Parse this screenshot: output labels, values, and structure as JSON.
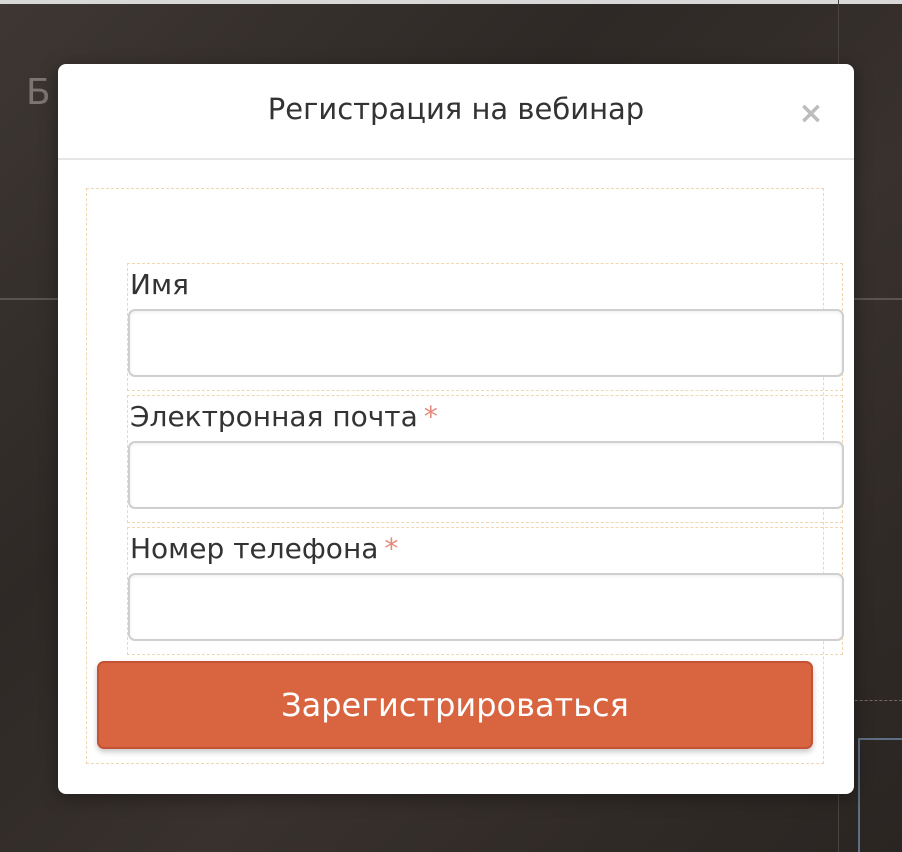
{
  "background": {
    "glyph": "Б"
  },
  "modal": {
    "title": "Регистрация на вебинар",
    "close_label": "×"
  },
  "form": {
    "fields": [
      {
        "label": "Имя",
        "required": false,
        "value": "",
        "placeholder": ""
      },
      {
        "label": "Электронная почта",
        "required": true,
        "value": "",
        "placeholder": ""
      },
      {
        "label": "Номер телефона",
        "required": true,
        "value": "",
        "placeholder": ""
      }
    ],
    "required_mark": "*",
    "submit_label": "Зарегистрироваться"
  },
  "colors": {
    "accent": "#d86440",
    "required": "#e48a7a",
    "backdrop": "#2e2926"
  },
  "icons": {
    "close": "close-icon"
  }
}
